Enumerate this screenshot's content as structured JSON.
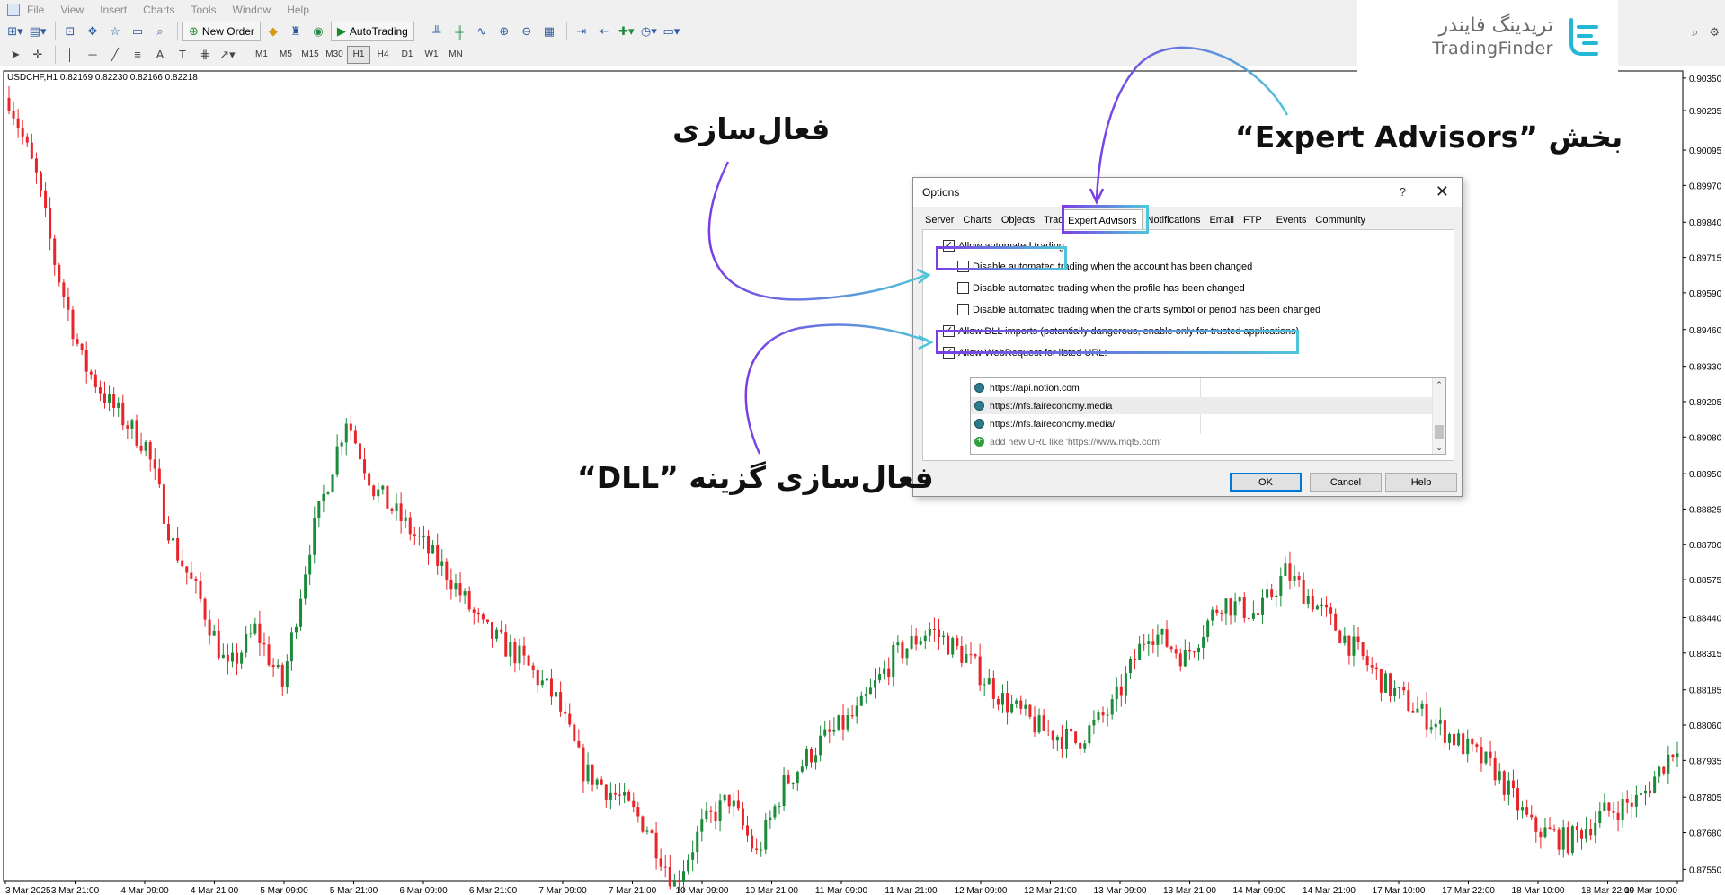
{
  "menu": [
    "File",
    "View",
    "Insert",
    "Charts",
    "Tools",
    "Window",
    "Help"
  ],
  "toolbar": {
    "new_order_label": "New Order",
    "auto_trading_label": "AutoTrading",
    "timeframes": [
      "M1",
      "M5",
      "M15",
      "M30",
      "H1",
      "H4",
      "D1",
      "W1",
      "MN"
    ],
    "active_timeframe": "H1"
  },
  "chart": {
    "symbol_line": "USDCHF,H1  0.82169 0.82230 0.82166 0.82218",
    "up_color": "#1b8a3a",
    "down_color": "#e8252a"
  },
  "chart_data": {
    "type": "candlestick",
    "symbol": "USDCHF",
    "timeframe": "H1",
    "y_ticks": [
      "0.90350",
      "0.90235",
      "0.90095",
      "0.89970",
      "0.89840",
      "0.89715",
      "0.89590",
      "0.89460",
      "0.89330",
      "0.89205",
      "0.89080",
      "0.88950",
      "0.88825",
      "0.88700",
      "0.88575",
      "0.88440",
      "0.88315",
      "0.88185",
      "0.88060",
      "0.87935",
      "0.87805",
      "0.87680",
      "0.87550"
    ],
    "x_ticks": [
      "3 Mar 2025",
      "3 Mar 21:00",
      "4 Mar 09:00",
      "4 Mar 21:00",
      "5 Mar 09:00",
      "5 Mar 21:00",
      "6 Mar 09:00",
      "6 Mar 21:00",
      "7 Mar 09:00",
      "7 Mar 21:00",
      "10 Mar 09:00",
      "10 Mar 21:00",
      "11 Mar 09:00",
      "11 Mar 21:00",
      "12 Mar 09:00",
      "12 Mar 21:00",
      "13 Mar 09:00",
      "13 Mar 21:00",
      "14 Mar 09:00",
      "14 Mar 21:00",
      "17 Mar 10:00",
      "17 Mar 22:00",
      "18 Mar 10:00",
      "18 Mar 22:00",
      "19 Mar 10:00"
    ],
    "close_path": [
      [
        0,
        0.9028
      ],
      [
        6,
        0.9
      ],
      [
        10,
        0.897
      ],
      [
        16,
        0.8935
      ],
      [
        22,
        0.892
      ],
      [
        30,
        0.8905
      ],
      [
        36,
        0.887
      ],
      [
        42,
        0.885
      ],
      [
        48,
        0.8825
      ],
      [
        54,
        0.884
      ],
      [
        60,
        0.882
      ],
      [
        66,
        0.887
      ],
      [
        74,
        0.8915
      ],
      [
        80,
        0.889
      ],
      [
        88,
        0.8875
      ],
      [
        96,
        0.886
      ],
      [
        104,
        0.884
      ],
      [
        112,
        0.883
      ],
      [
        120,
        0.8815
      ],
      [
        126,
        0.879
      ],
      [
        134,
        0.878
      ],
      [
        140,
        0.877
      ],
      [
        146,
        0.875
      ],
      [
        152,
        0.877
      ],
      [
        158,
        0.878
      ],
      [
        164,
        0.876
      ],
      [
        170,
        0.8785
      ],
      [
        178,
        0.88
      ],
      [
        186,
        0.881
      ],
      [
        194,
        0.883
      ],
      [
        202,
        0.884
      ],
      [
        210,
        0.883
      ],
      [
        218,
        0.8815
      ],
      [
        226,
        0.8805
      ],
      [
        234,
        0.88
      ],
      [
        242,
        0.8812
      ],
      [
        250,
        0.884
      ],
      [
        258,
        0.883
      ],
      [
        266,
        0.885
      ],
      [
        274,
        0.8845
      ],
      [
        280,
        0.886
      ],
      [
        286,
        0.885
      ],
      [
        294,
        0.8835
      ],
      [
        302,
        0.882
      ],
      [
        310,
        0.881
      ],
      [
        318,
        0.88
      ],
      [
        326,
        0.879
      ],
      [
        334,
        0.877
      ],
      [
        342,
        0.8765
      ],
      [
        350,
        0.8775
      ],
      [
        358,
        0.878
      ],
      [
        366,
        0.88
      ]
    ]
  },
  "dialog": {
    "title": "Options",
    "help_glyph": "?",
    "close_glyph": "✕",
    "tabs": [
      "Server",
      "Charts",
      "Objects",
      "Trade",
      "Expert Advisors",
      "Notifications",
      "Email",
      "FTP",
      "Events",
      "Community"
    ],
    "active_tab": "Expert Advisors",
    "options": {
      "allow_auto": {
        "label": "Allow automated trading",
        "checked": true
      },
      "disable_account": {
        "label": "Disable automated trading when the account has been changed",
        "checked": false
      },
      "disable_profile": {
        "label": "Disable automated trading when the profile has been changed",
        "checked": false
      },
      "disable_symbol": {
        "label": "Disable automated trading when the charts symbol or period has been changed",
        "checked": false
      },
      "allow_dll": {
        "label": "Allow DLL imports (potentially dangerous, enable only for trusted applications)",
        "checked": true
      },
      "allow_webrequest": {
        "label": "Allow WebRequest for listed URL:",
        "checked": true
      }
    },
    "urls": [
      "https://api.notion.com",
      "https://nfs.faireconomy.media",
      "https://nfs.faireconomy.media/"
    ],
    "add_url_placeholder": "add new URL like 'https://www.mql5.com'",
    "buttons": {
      "ok": "OK",
      "cancel": "Cancel",
      "help": "Help"
    }
  },
  "brand": {
    "fa": "تریدینگ فایندر",
    "en": "TradingFinder",
    "accent": "#27b7d6"
  },
  "annotations": {
    "expert_advisors": "بخش ”Expert Advisors“",
    "activation": "فعال‌سازی",
    "dll": "فعال‌سازی گزینه ”DLL“"
  },
  "gradient": {
    "start": "#7a3fe4",
    "end": "#4fc5da"
  }
}
